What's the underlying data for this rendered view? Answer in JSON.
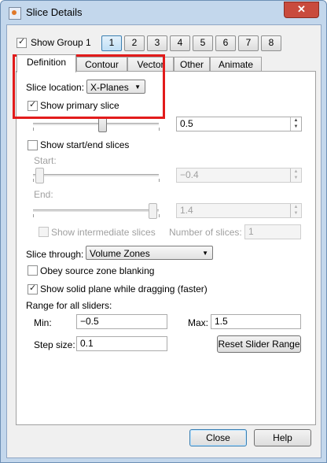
{
  "window": {
    "title": "Slice Details",
    "close_glyph": "✕"
  },
  "group": {
    "label": "Show Group 1",
    "checked": true,
    "buttons": [
      "1",
      "2",
      "3",
      "4",
      "5",
      "6",
      "7",
      "8"
    ],
    "active": "1"
  },
  "tabs": [
    "Definition",
    "Contour",
    "Vector",
    "Other",
    "Animate"
  ],
  "active_tab": "Definition",
  "slice_location": {
    "label": "Slice location:",
    "value": "X-Planes"
  },
  "primary_slice": {
    "label": "Show primary slice",
    "checked": true,
    "value": "0.5",
    "slider_fraction": 0.55
  },
  "start_end": {
    "label": "Show start/end slices",
    "checked": false,
    "start_label": "Start:",
    "start_value": "−0.4",
    "start_fraction": 0.05,
    "end_label": "End:",
    "end_value": "1.4",
    "end_fraction": 0.95
  },
  "intermediate": {
    "label": "Show intermediate slices",
    "number_label": "Number of slices:",
    "number_value": "1"
  },
  "slice_through": {
    "label": "Slice through:",
    "value": "Volume Zones"
  },
  "obey_zone": {
    "label": "Obey source zone blanking",
    "checked": false
  },
  "solid_plane": {
    "label": "Show solid plane while dragging (faster)",
    "checked": true
  },
  "range": {
    "label": "Range for all sliders:",
    "min_label": "Min:",
    "min_value": "−0.5",
    "max_label": "Max:",
    "max_value": "1.5",
    "step_label": "Step size:",
    "step_value": "0.1",
    "reset_label": "Reset Slider Range"
  },
  "footer": {
    "close_label": "Close",
    "help_label": "Help"
  },
  "colors": {
    "highlight": "#e21b1b",
    "active_tab_button": "#3c7fb1"
  }
}
